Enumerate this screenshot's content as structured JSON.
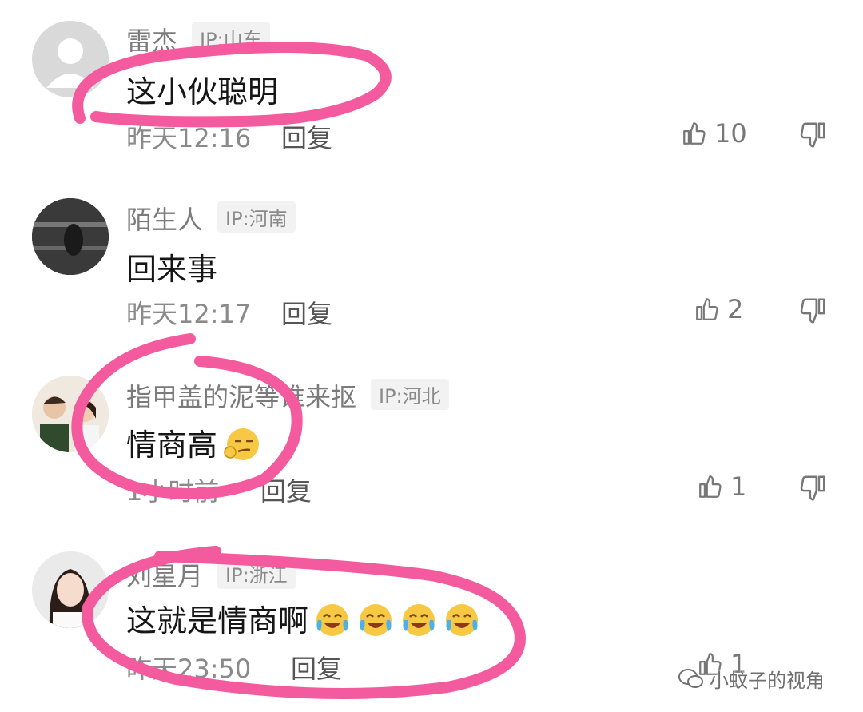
{
  "comments": [
    {
      "user": "雷杰",
      "ip": "IP:山东",
      "text": "这小伙聪明",
      "time": "昨天12:16",
      "reply": "回复",
      "likes": "10",
      "avatar": "default-avatar-icon"
    },
    {
      "user": "陌生人",
      "ip": "IP:河南",
      "text": "回来事",
      "time": "昨天12:17",
      "reply": "回复",
      "likes": "2",
      "avatar": "dark-photo-avatar"
    },
    {
      "user": "指甲盖的泥等谁来抠",
      "ip": "IP:河北",
      "text": "情商高",
      "time": "1小时前",
      "reply": "回复",
      "likes": "1",
      "avatar": "children-photo-avatar"
    },
    {
      "user": "刘星月",
      "ip": "IP:浙江",
      "text": "这就是情商啊",
      "time": "昨天23:50",
      "reply": "回复",
      "likes": "1",
      "avatar": "girl-photo-avatar"
    }
  ],
  "watermark": "小蚊子的视角",
  "colors": {
    "annotation_ink": "#f45a9e",
    "muted_text": "#8a8a8a"
  }
}
